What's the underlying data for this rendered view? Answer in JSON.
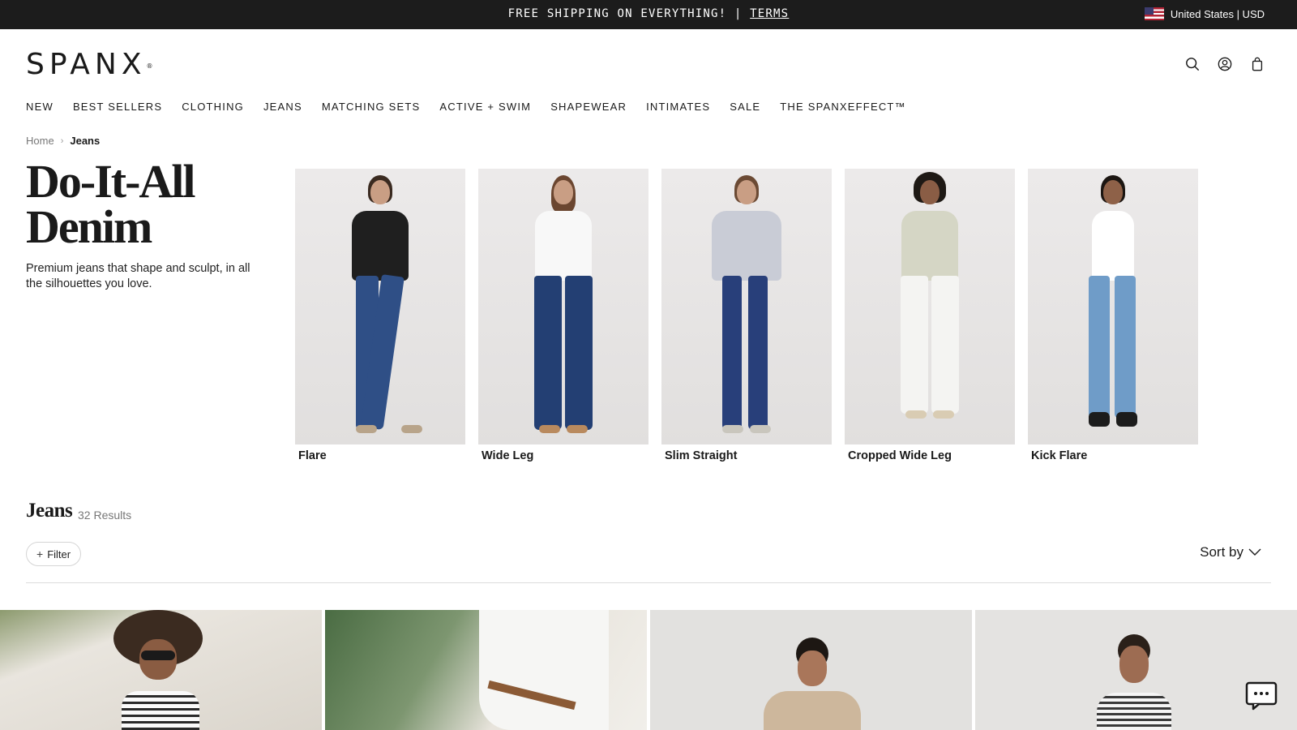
{
  "announcement": {
    "promo_text": "FREE SHIPPING ON EVERYTHING! | ",
    "terms_link": "TERMS",
    "locale": "United States | USD"
  },
  "header": {
    "logo": "SPANX",
    "logo_mark": "®",
    "icons": [
      "search-icon",
      "account-icon",
      "bag-icon"
    ]
  },
  "nav": {
    "items": [
      "NEW",
      "BEST SELLERS",
      "CLOTHING",
      "JEANS",
      "MATCHING SETS",
      "ACTIVE + SWIM",
      "SHAPEWEAR",
      "INTIMATES",
      "SALE",
      "THE SPANXEFFECT™"
    ]
  },
  "breadcrumb": {
    "home": "Home",
    "current": "Jeans"
  },
  "hero": {
    "title": "Do-It-All Denim",
    "description": "Premium jeans that shape and sculpt, in all the silhouettes you love."
  },
  "categories": [
    {
      "label": "Flare",
      "top_color": "#1f1f1f",
      "denim_color": "#2f4f86"
    },
    {
      "label": "Wide Leg",
      "top_color": "#f8f8f8",
      "denim_color": "#233f73"
    },
    {
      "label": "Slim Straight",
      "top_color": "#c9ccd6",
      "denim_color": "#283f7a"
    },
    {
      "label": "Cropped Wide Leg",
      "top_color": "#d5d6c5",
      "denim_color": "#f4f4f2"
    },
    {
      "label": "Kick Flare",
      "top_color": "#ffffff",
      "denim_color": "#6f9cc8"
    }
  ],
  "results": {
    "title": "Jeans",
    "count": "32 Results",
    "filter_label": "Filter",
    "sort_label": "Sort by"
  },
  "colors": {
    "announcement_bg": "#1c1c1c",
    "text": "#1a1a1a"
  }
}
